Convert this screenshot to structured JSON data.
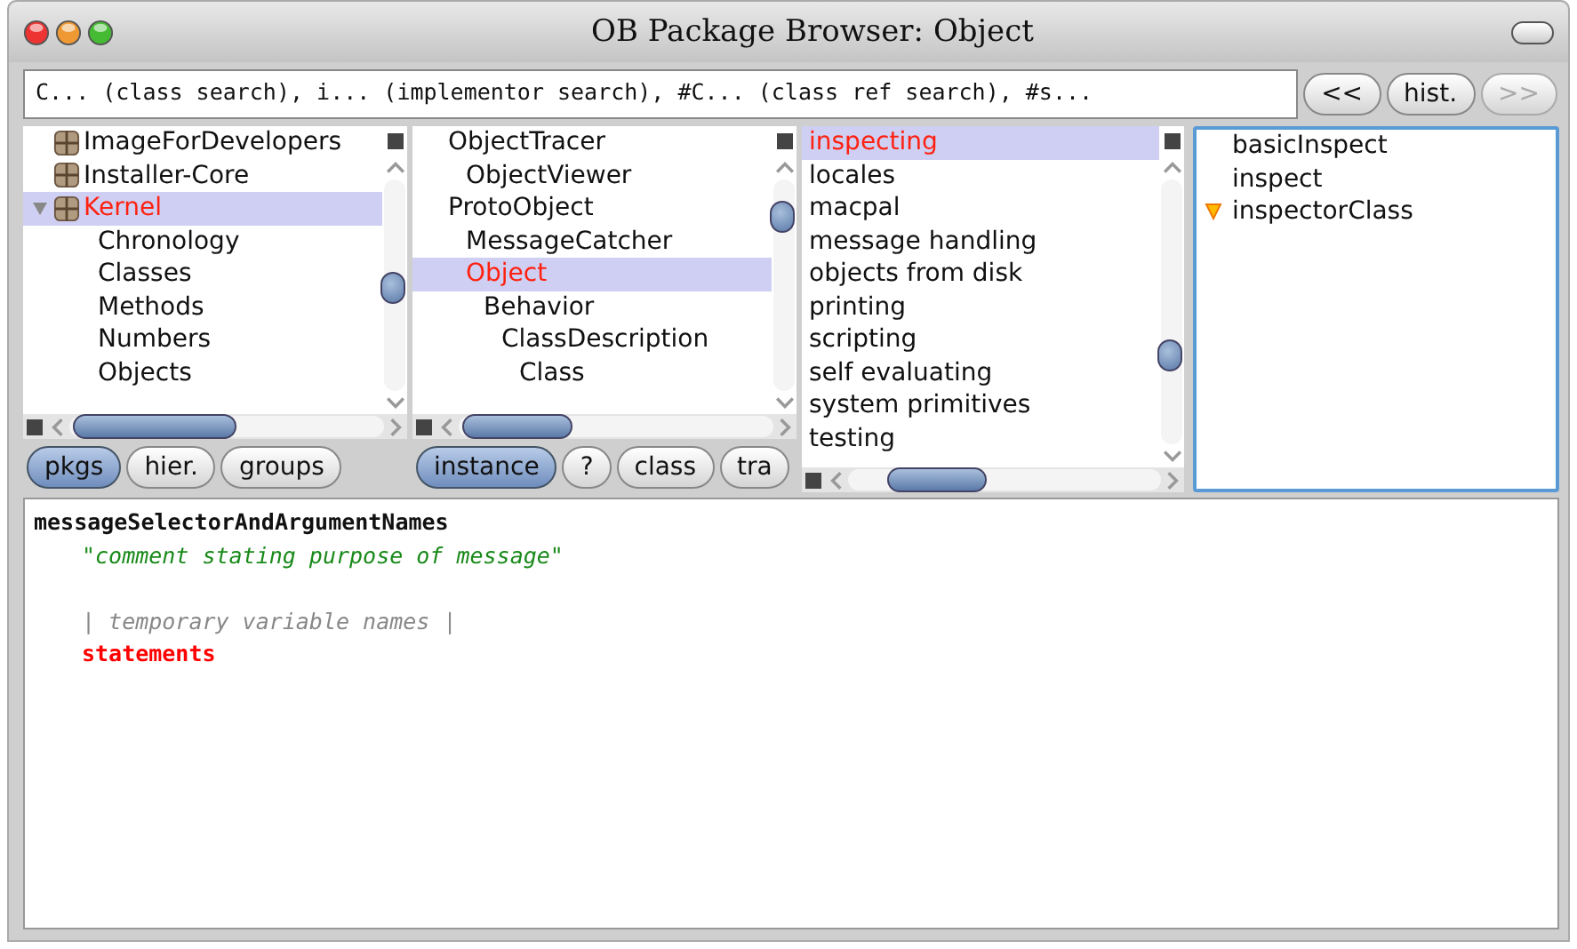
{
  "window": {
    "title": "OB Package Browser: Object"
  },
  "search": {
    "value": "C... (class search), i... (implementor search), #C... (class ref search), #s..."
  },
  "history_buttons": [
    {
      "label": "<<",
      "disabled": false
    },
    {
      "label": "hist.",
      "disabled": false
    },
    {
      "label": ">>",
      "disabled": true
    }
  ],
  "packages": {
    "items": [
      {
        "label": "ImageForDevelopers",
        "selected": false,
        "expanded": false
      },
      {
        "label": "Installer-Core",
        "selected": false,
        "expanded": false
      },
      {
        "label": "Kernel",
        "selected": true,
        "expanded": true,
        "children": [
          {
            "label": "Chronology",
            "selected": false
          },
          {
            "label": "Classes",
            "selected": false
          },
          {
            "label": "Methods",
            "selected": false
          },
          {
            "label": "Numbers",
            "selected": false
          },
          {
            "label": "Objects",
            "selected": false
          }
        ]
      }
    ]
  },
  "classes": {
    "items": [
      {
        "label": "ObjectTracer",
        "selected": false,
        "children": [
          {
            "label": "ObjectViewer",
            "selected": false
          }
        ]
      },
      {
        "label": "ProtoObject",
        "selected": false,
        "children": [
          {
            "label": "MessageCatcher",
            "selected": false
          },
          {
            "label": "Object",
            "selected": true,
            "children": [
              {
                "label": "Behavior",
                "selected": false,
                "children": [
                  {
                    "label": "ClassDescription",
                    "selected": false,
                    "children": [
                      {
                        "label": "Class",
                        "selected": false
                      }
                    ]
                  }
                ]
              }
            ]
          }
        ]
      }
    ]
  },
  "package_buttons": [
    {
      "label": "pkgs",
      "selected": true
    },
    {
      "label": "hier.",
      "selected": false
    },
    {
      "label": "groups",
      "selected": false
    }
  ],
  "class_buttons": [
    {
      "label": "instance",
      "selected": true
    },
    {
      "label": "?",
      "selected": false
    },
    {
      "label": "class",
      "selected": false
    },
    {
      "label": "tra",
      "selected": false
    }
  ],
  "protocols": [
    {
      "label": "inspecting",
      "selected": true
    },
    {
      "label": "locales",
      "selected": false
    },
    {
      "label": "macpal",
      "selected": false
    },
    {
      "label": "message handling",
      "selected": false
    },
    {
      "label": "objects from disk",
      "selected": false
    },
    {
      "label": "printing",
      "selected": false
    },
    {
      "label": "scripting",
      "selected": false
    },
    {
      "label": "self evaluating",
      "selected": false
    },
    {
      "label": "system primitives",
      "selected": false
    },
    {
      "label": "testing",
      "selected": false
    }
  ],
  "methods": [
    {
      "label": "basicInspect",
      "overridden": false
    },
    {
      "label": "inspect",
      "overridden": false
    },
    {
      "label": "inspectorClass",
      "overridden": true
    }
  ],
  "code": [
    {
      "kind": "selector",
      "text": "messageSelectorAndArgumentNames"
    },
    {
      "kind": "comment",
      "text": "\"comment stating purpose of message\""
    },
    {
      "kind": "temps",
      "text": "| temporary variable names |"
    },
    {
      "kind": "statements",
      "text": "statements"
    }
  ]
}
